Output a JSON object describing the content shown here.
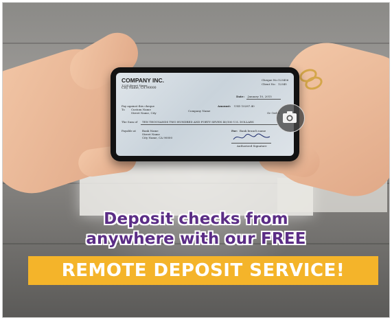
{
  "headline": {
    "line1": "Deposit checks from",
    "line2": "anywhere with our FREE",
    "banner": "REMOTE DEPOSIT SERVICE!"
  },
  "check": {
    "company": "COMPANY INC.",
    "address1": "1234 Street Name",
    "address2": "City Name, CA 90000",
    "cheque_no_label": "Cheque No:",
    "cheque_no": "123456",
    "client_no_label": "Client No:",
    "client_no": "12345",
    "date_label": "Date:",
    "date": "January 10, 2015",
    "pay_label": "Pay against this cheque",
    "to_label": "To",
    "payee_name": "Custom Name",
    "payee_street": "Street Name, City",
    "payee_company": "Company Name",
    "amount_label": "Amount:",
    "amount": "USD 10287.40",
    "sum_label": "The Sum of",
    "sum_words": "TEN THOUSANDS TWO HUNDRED AND FORTY SEVEN 40/100 U.S. DOLLARS",
    "payable_label": "Payable at",
    "bank_name": "Bank Name",
    "bank_street": "Street Name",
    "bank_city": "City Name, CA 90000",
    "for_label": "For:",
    "branch": "Bank branch name",
    "signature_label": "Authorized Signature",
    "or_order": "Or Order"
  },
  "icons": {
    "camera": "camera-icon"
  },
  "colors": {
    "headline": "#5b2d86",
    "banner": "#f4b42a",
    "banner_text": "#ffffff"
  }
}
